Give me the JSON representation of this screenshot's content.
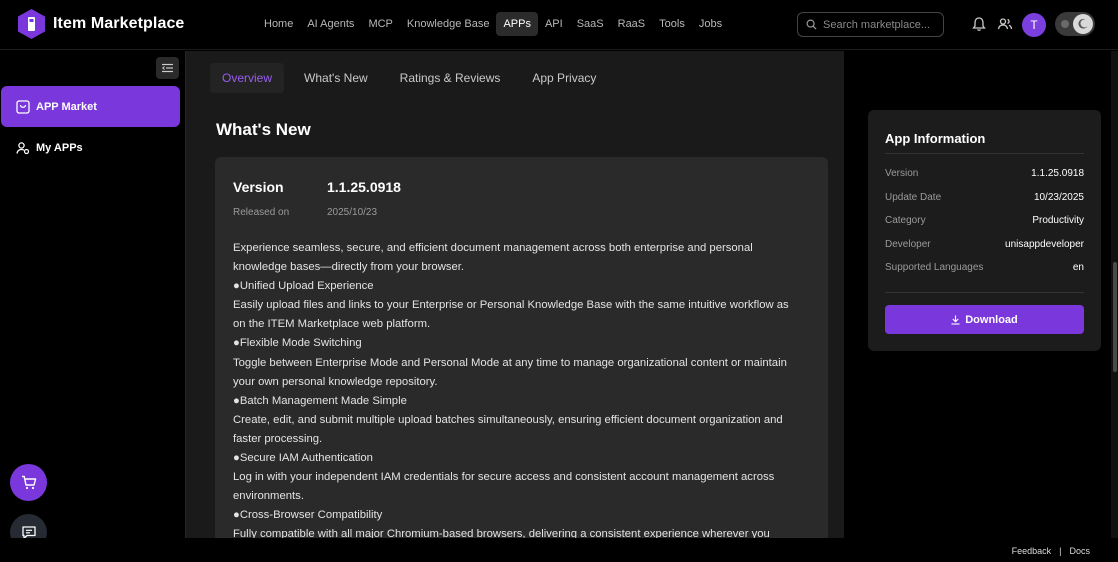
{
  "header": {
    "app_title": "Item Marketplace",
    "nav": [
      "Home",
      "AI Agents",
      "MCP",
      "Knowledge Base",
      "APPs",
      "API",
      "SaaS",
      "RaaS",
      "Tools",
      "Jobs"
    ],
    "active_nav": "APPs",
    "search_placeholder": "Search marketplace...",
    "avatar_letter": "T"
  },
  "sidebar": {
    "items": [
      {
        "label": "APP Market",
        "icon": "store-icon",
        "active": true
      },
      {
        "label": "My APPs",
        "icon": "user-apps-icon",
        "active": false
      }
    ]
  },
  "tabs": [
    "Overview",
    "What's New",
    "Ratings & Reviews",
    "App Privacy"
  ],
  "active_tab": "Overview",
  "whats_new": {
    "title": "What's New",
    "version_label": "Version",
    "version_value": "1.1.25.0918",
    "released_label": "Released on",
    "released_value": "2025/10/23",
    "lines": [
      "Experience seamless, secure, and efficient document management across both enterprise and personal",
      "knowledge bases—directly from your browser.",
      "●Unified Upload Experience",
      "Easily upload files and links to your Enterprise or Personal Knowledge Base with the same intuitive workflow as",
      "on the ITEM Marketplace web platform.",
      "●Flexible Mode Switching",
      "Toggle between Enterprise Mode and Personal Mode at any time to manage organizational content or maintain",
      "your own personal knowledge repository.",
      "●Batch Management Made Simple",
      "Create, edit, and submit multiple upload batches simultaneously, ensuring efficient document organization and",
      "faster processing.",
      "●Secure IAM Authentication",
      "Log in with your independent IAM credentials for secure access and consistent account management across",
      "environments.",
      "●Cross-Browser Compatibility",
      "Fully compatible with all major Chromium-based browsers, delivering a consistent experience wherever you"
    ]
  },
  "app_info": {
    "title": "App Information",
    "rows": [
      {
        "key": "Version",
        "value": "1.1.25.0918"
      },
      {
        "key": "Update Date",
        "value": "10/23/2025"
      },
      {
        "key": "Category",
        "value": "Productivity"
      },
      {
        "key": "Developer",
        "value": "unisappdeveloper"
      },
      {
        "key": "Supported Languages",
        "value": "en"
      }
    ],
    "download_label": "Download"
  },
  "footer": {
    "feedback": "Feedback",
    "separator": "|",
    "docs": "Docs"
  },
  "colors": {
    "accent": "#7a38dc",
    "tab_active_text": "#9a5cf0"
  }
}
